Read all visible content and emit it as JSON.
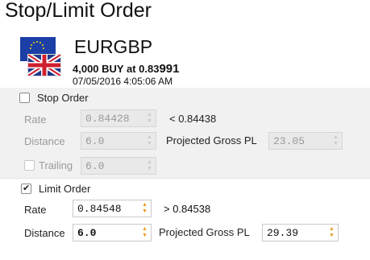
{
  "title": "Stop/Limit Order",
  "instrument": {
    "symbol": "EURGBP",
    "trade_prefix": "4,000 BUY at 0.83",
    "trade_pips": "991",
    "datetime": "07/05/2016 4:05:06 AM",
    "flags": [
      "eu-flag-icon",
      "uk-flag-icon"
    ]
  },
  "stop": {
    "label": "Stop Order",
    "checked": false,
    "rate_label": "Rate",
    "rate_value": "0.84428",
    "rate_hint": "< 0.84438",
    "distance_label": "Distance",
    "distance_value": "6.0",
    "gross_label": "Projected Gross PL",
    "gross_value": "23.05",
    "trailing_label": "Trailing",
    "trailing_checked": false,
    "trailing_value": "6.0"
  },
  "limit": {
    "label": "Limit Order",
    "checked": true,
    "rate_label": "Rate",
    "rate_value": "0.84548",
    "rate_hint": "> 0.84538",
    "distance_label": "Distance",
    "distance_value": "6.0",
    "gross_label": "Projected Gross PL",
    "gross_value": "29.39"
  },
  "colors": {
    "accent": "#e69a1e",
    "panel_bg": "#f1f1f1",
    "disabled_field": "#e9e9e9"
  }
}
